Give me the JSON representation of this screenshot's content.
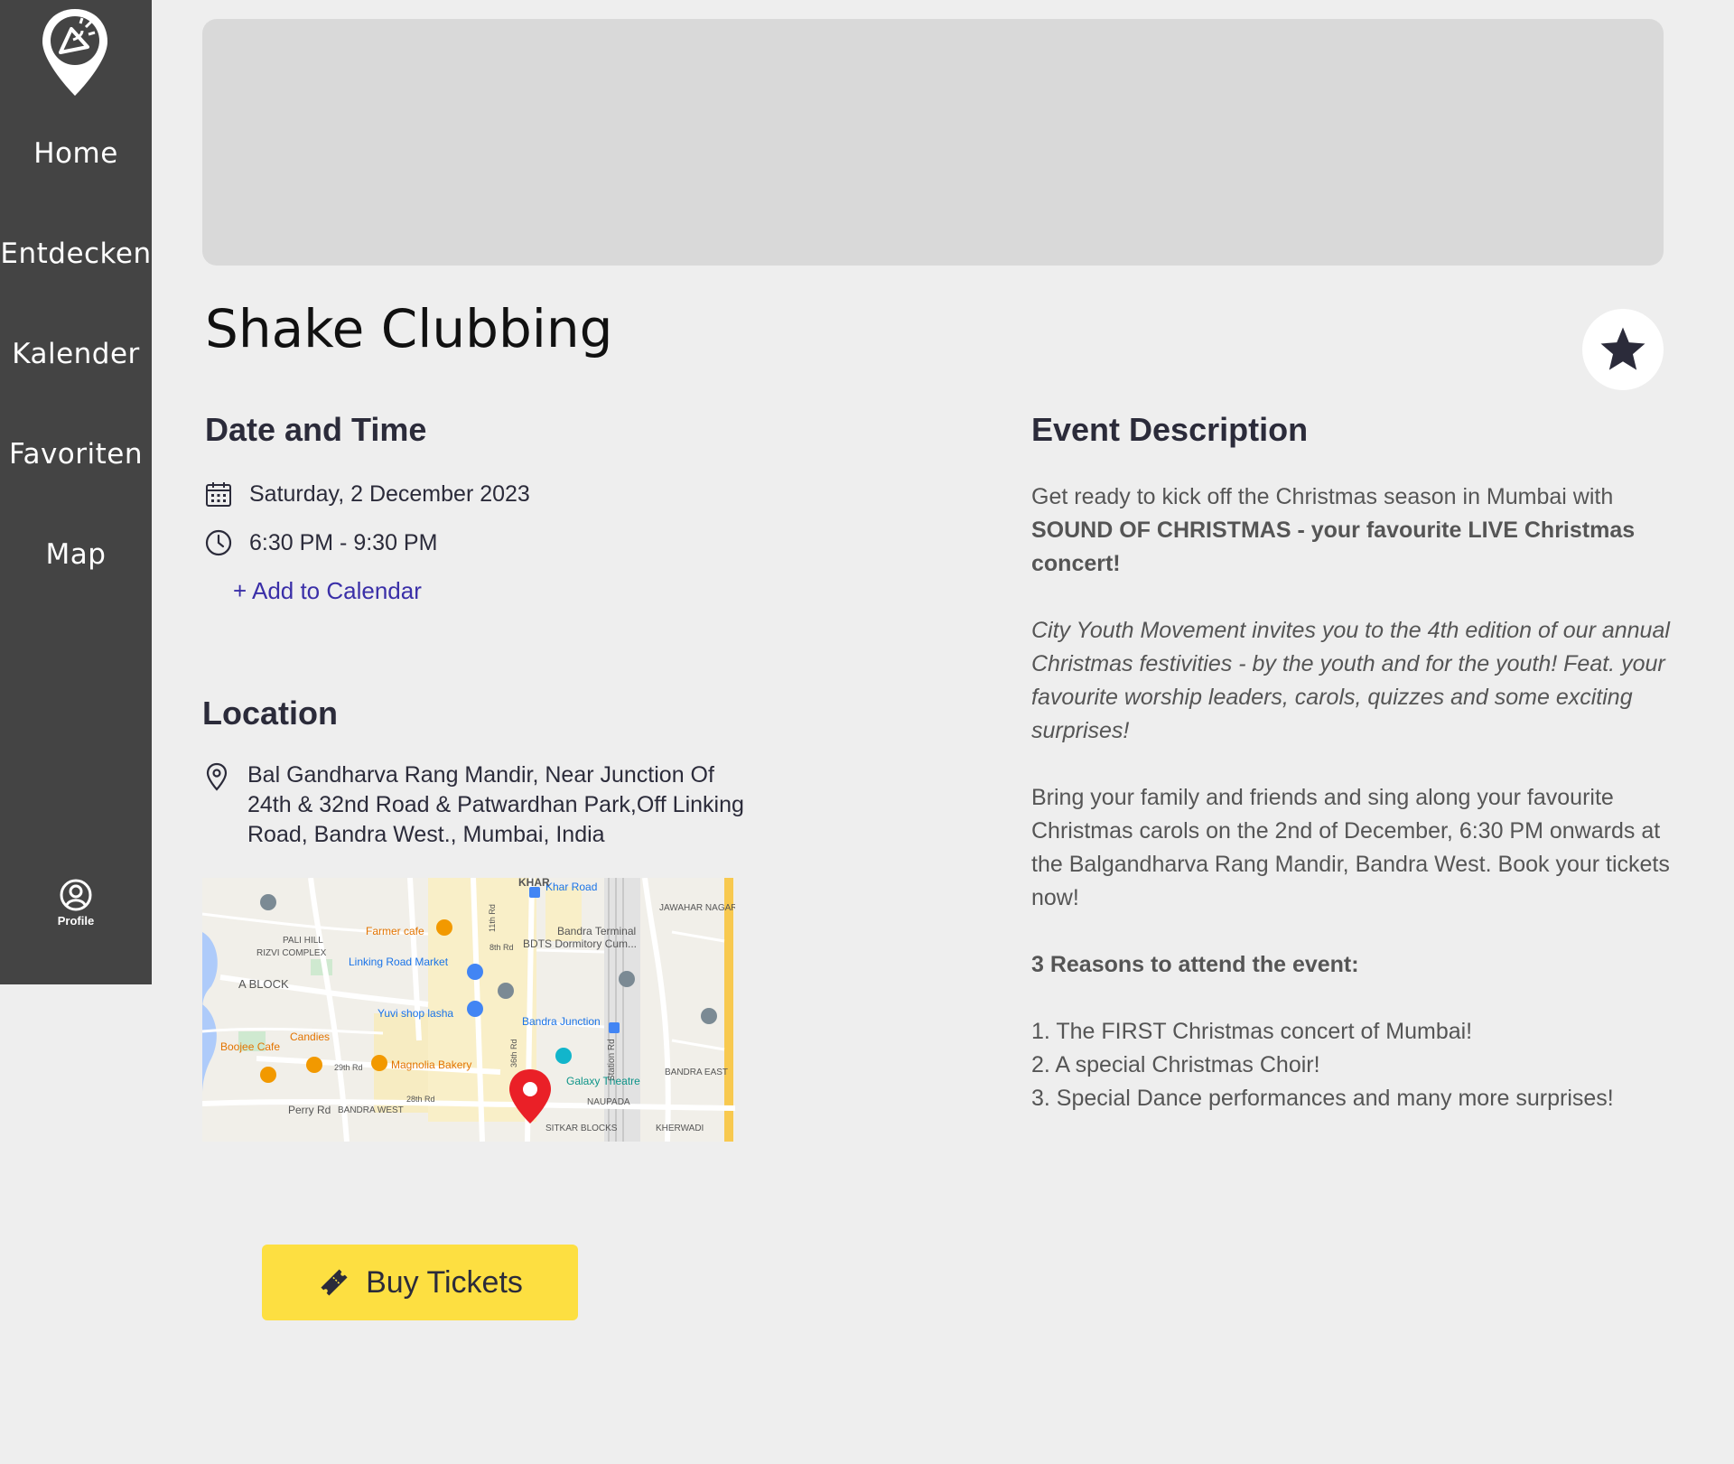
{
  "nav": {
    "items": [
      {
        "label": "Home"
      },
      {
        "label": "Entdecken"
      },
      {
        "label": "Kalender"
      },
      {
        "label": "Favoriten"
      },
      {
        "label": "Map"
      }
    ],
    "profile_label": "Profile"
  },
  "event": {
    "title": "Shake Clubbing"
  },
  "datetime": {
    "heading": "Date and Time",
    "date": "Saturday, 2 December 2023",
    "time": "6:30 PM - 9:30 PM",
    "add_to_calendar": "+ Add to Calendar"
  },
  "location": {
    "heading": "Location",
    "address": "Bal Gandharva Rang Mandir, Near Junction Of 24th & 32nd Road & Patwardhan Park,Off Linking Road, Bandra West., Mumbai, India",
    "map_labels": {
      "khar_road": "Khar Road",
      "farmer_cafe": "Farmer cafe",
      "bandra_terminal": "Bandra Terminal",
      "bdts": "BDTS Dormitory Cum...",
      "pali_hill": "PALI HILL",
      "rizvi": "RIZVI COMPLEX",
      "linking_road_market": "Linking Road Market",
      "a_block": "A BLOCK",
      "yuvi": "Yuvi shop lasha",
      "bandra_junction": "Bandra Junction",
      "candies": "Candies",
      "boojee": "Boojee Cafe",
      "magnolia": "Magnolia Bakery",
      "galaxy": "Galaxy Theatre",
      "naupada": "NAUPADA",
      "bandra_east": "BANDRA EAST",
      "perry_rd": "Perry Rd",
      "bandra_west": "BANDRA WEST",
      "kherwadi": "KHERWADI",
      "jawahar_nagar": "JAWAHAR NAGAR",
      "khar": "KHAR",
      "station_rd": "Station Rd",
      "sitkar": "SITKAR BLOCKS",
      "rd_29": "29th Rd",
      "rd_28": "28th Rd",
      "rd_8": "8th Rd",
      "rd_36": "36th Rd",
      "rd_11": "11th Rd"
    }
  },
  "buy_button_label": "Buy Tickets",
  "description": {
    "heading": "Event Description",
    "intro": "Get ready to kick off the Christmas season in Mumbai with ",
    "intro_bold": "SOUND OF CHRISTMAS - your favourite LIVE Christmas concert!",
    "italic_paragraph": "City Youth Movement invites you to the 4th edition of our annual Christmas festivities - by the youth and for the youth! Feat. your favourite worship leaders, carols, quizzes and some exciting surprises!",
    "paragraph3": "Bring your family and friends and sing along your favourite Christmas carols on the 2nd of December, 6:30 PM onwards at the Balgandharva Rang Mandir, Bandra West. Book your tickets now!",
    "reasons_heading": "3 Reasons to attend the event:",
    "reasons": [
      "1. The FIRST Christmas concert of Mumbai!",
      "2. A special Christmas Choir!",
      "3. Special Dance performances and many more surprises!"
    ]
  },
  "colors": {
    "sidebar": "#444444",
    "background": "#eeeeee",
    "accent_link": "#3a2fa8",
    "buy_button": "#fddf41",
    "star": "#2b2b3a"
  }
}
